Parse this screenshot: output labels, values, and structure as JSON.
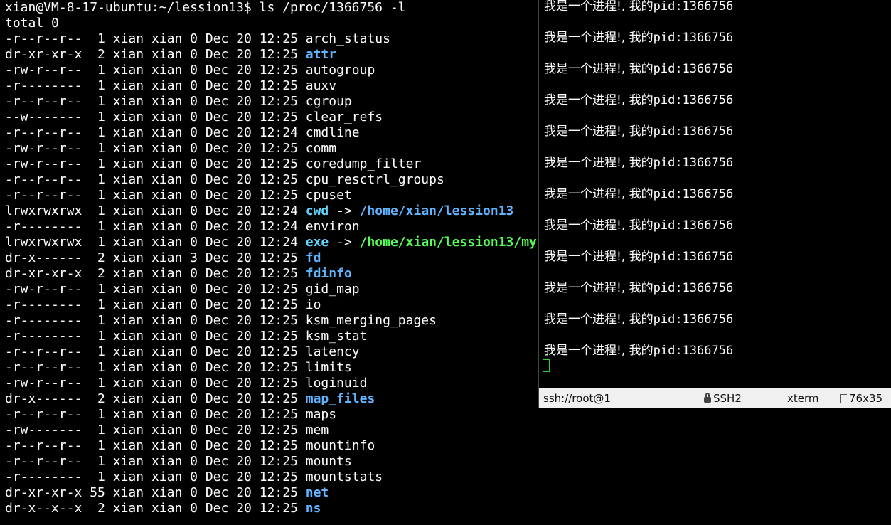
{
  "left_terminal": {
    "prompt": "xian@VM-8-17-ubuntu:~/lession13$ ls /proc/1366756 -l",
    "total": "total 0",
    "entries": [
      {
        "perm": "-r--r--r--",
        "links": " 1",
        "owner": "xian",
        "group": "xian",
        "size": "0",
        "date": "Dec 20",
        "time": "12:25",
        "name": "arch_status",
        "type": "file"
      },
      {
        "perm": "dr-xr-xr-x",
        "links": " 2",
        "owner": "xian",
        "group": "xian",
        "size": "0",
        "date": "Dec 20",
        "time": "12:25",
        "name": "attr",
        "type": "dir"
      },
      {
        "perm": "-rw-r--r--",
        "links": " 1",
        "owner": "xian",
        "group": "xian",
        "size": "0",
        "date": "Dec 20",
        "time": "12:25",
        "name": "autogroup",
        "type": "file"
      },
      {
        "perm": "-r--------",
        "links": " 1",
        "owner": "xian",
        "group": "xian",
        "size": "0",
        "date": "Dec 20",
        "time": "12:25",
        "name": "auxv",
        "type": "file"
      },
      {
        "perm": "-r--r--r--",
        "links": " 1",
        "owner": "xian",
        "group": "xian",
        "size": "0",
        "date": "Dec 20",
        "time": "12:25",
        "name": "cgroup",
        "type": "file"
      },
      {
        "perm": "--w-------",
        "links": " 1",
        "owner": "xian",
        "group": "xian",
        "size": "0",
        "date": "Dec 20",
        "time": "12:25",
        "name": "clear_refs",
        "type": "file"
      },
      {
        "perm": "-r--r--r--",
        "links": " 1",
        "owner": "xian",
        "group": "xian",
        "size": "0",
        "date": "Dec 20",
        "time": "12:24",
        "name": "cmdline",
        "type": "file"
      },
      {
        "perm": "-rw-r--r--",
        "links": " 1",
        "owner": "xian",
        "group": "xian",
        "size": "0",
        "date": "Dec 20",
        "time": "12:25",
        "name": "comm",
        "type": "file"
      },
      {
        "perm": "-rw-r--r--",
        "links": " 1",
        "owner": "xian",
        "group": "xian",
        "size": "0",
        "date": "Dec 20",
        "time": "12:25",
        "name": "coredump_filter",
        "type": "file"
      },
      {
        "perm": "-r--r--r--",
        "links": " 1",
        "owner": "xian",
        "group": "xian",
        "size": "0",
        "date": "Dec 20",
        "time": "12:25",
        "name": "cpu_resctrl_groups",
        "type": "file"
      },
      {
        "perm": "-r--r--r--",
        "links": " 1",
        "owner": "xian",
        "group": "xian",
        "size": "0",
        "date": "Dec 20",
        "time": "12:25",
        "name": "cpuset",
        "type": "file"
      },
      {
        "perm": "lrwxrwxrwx",
        "links": " 1",
        "owner": "xian",
        "group": "xian",
        "size": "0",
        "date": "Dec 20",
        "time": "12:24",
        "name": "cwd",
        "type": "link",
        "arrow": " -> ",
        "target": "/home/xian/lession13",
        "target_type": "dir"
      },
      {
        "perm": "-r--------",
        "links": " 1",
        "owner": "xian",
        "group": "xian",
        "size": "0",
        "date": "Dec 20",
        "time": "12:24",
        "name": "environ",
        "type": "file"
      },
      {
        "perm": "lrwxrwxrwx",
        "links": " 1",
        "owner": "xian",
        "group": "xian",
        "size": "0",
        "date": "Dec 20",
        "time": "12:24",
        "name": "exe",
        "type": "link",
        "arrow": " -> ",
        "target": "/home/xian/lession13/my",
        "target_type": "exe"
      },
      {
        "perm": "dr-x------",
        "links": " 2",
        "owner": "xian",
        "group": "xian",
        "size": "3",
        "date": "Dec 20",
        "time": "12:25",
        "name": "fd",
        "type": "dir"
      },
      {
        "perm": "dr-xr-xr-x",
        "links": " 2",
        "owner": "xian",
        "group": "xian",
        "size": "0",
        "date": "Dec 20",
        "time": "12:25",
        "name": "fdinfo",
        "type": "dir"
      },
      {
        "perm": "-rw-r--r--",
        "links": " 1",
        "owner": "xian",
        "group": "xian",
        "size": "0",
        "date": "Dec 20",
        "time": "12:25",
        "name": "gid_map",
        "type": "file"
      },
      {
        "perm": "-r--------",
        "links": " 1",
        "owner": "xian",
        "group": "xian",
        "size": "0",
        "date": "Dec 20",
        "time": "12:25",
        "name": "io",
        "type": "file"
      },
      {
        "perm": "-r--------",
        "links": " 1",
        "owner": "xian",
        "group": "xian",
        "size": "0",
        "date": "Dec 20",
        "time": "12:25",
        "name": "ksm_merging_pages",
        "type": "file"
      },
      {
        "perm": "-r--------",
        "links": " 1",
        "owner": "xian",
        "group": "xian",
        "size": "0",
        "date": "Dec 20",
        "time": "12:25",
        "name": "ksm_stat",
        "type": "file"
      },
      {
        "perm": "-r--r--r--",
        "links": " 1",
        "owner": "xian",
        "group": "xian",
        "size": "0",
        "date": "Dec 20",
        "time": "12:25",
        "name": "latency",
        "type": "file"
      },
      {
        "perm": "-r--r--r--",
        "links": " 1",
        "owner": "xian",
        "group": "xian",
        "size": "0",
        "date": "Dec 20",
        "time": "12:25",
        "name": "limits",
        "type": "file"
      },
      {
        "perm": "-rw-r--r--",
        "links": " 1",
        "owner": "xian",
        "group": "xian",
        "size": "0",
        "date": "Dec 20",
        "time": "12:25",
        "name": "loginuid",
        "type": "file"
      },
      {
        "perm": "dr-x------",
        "links": " 2",
        "owner": "xian",
        "group": "xian",
        "size": "0",
        "date": "Dec 20",
        "time": "12:25",
        "name": "map_files",
        "type": "dir"
      },
      {
        "perm": "-r--r--r--",
        "links": " 1",
        "owner": "xian",
        "group": "xian",
        "size": "0",
        "date": "Dec 20",
        "time": "12:25",
        "name": "maps",
        "type": "file"
      },
      {
        "perm": "-rw-------",
        "links": " 1",
        "owner": "xian",
        "group": "xian",
        "size": "0",
        "date": "Dec 20",
        "time": "12:25",
        "name": "mem",
        "type": "file"
      },
      {
        "perm": "-r--r--r--",
        "links": " 1",
        "owner": "xian",
        "group": "xian",
        "size": "0",
        "date": "Dec 20",
        "time": "12:25",
        "name": "mountinfo",
        "type": "file"
      },
      {
        "perm": "-r--r--r--",
        "links": " 1",
        "owner": "xian",
        "group": "xian",
        "size": "0",
        "date": "Dec 20",
        "time": "12:25",
        "name": "mounts",
        "type": "file"
      },
      {
        "perm": "-r--------",
        "links": " 1",
        "owner": "xian",
        "group": "xian",
        "size": "0",
        "date": "Dec 20",
        "time": "12:25",
        "name": "mountstats",
        "type": "file"
      },
      {
        "perm": "dr-xr-xr-x",
        "links": "55",
        "owner": "xian",
        "group": "xian",
        "size": "0",
        "date": "Dec 20",
        "time": "12:25",
        "name": "net",
        "type": "dir"
      },
      {
        "perm": "dr-x--x--x",
        "links": " 2",
        "owner": "xian",
        "group": "xian",
        "size": "0",
        "date": "Dec 20",
        "time": "12:25",
        "name": "ns",
        "type": "dir"
      }
    ]
  },
  "right_terminal": {
    "output_lines": [
      {
        "text": "我是一个进程!, 我的",
        "pid": "pid:1366756"
      },
      {
        "text": "我是一个进程!, 我的",
        "pid": "pid:1366756"
      },
      {
        "text": "我是一个进程!, 我的",
        "pid": "pid:1366756"
      },
      {
        "text": "我是一个进程!, 我的",
        "pid": "pid:1366756"
      },
      {
        "text": "我是一个进程!, 我的",
        "pid": "pid:1366756"
      },
      {
        "text": "我是一个进程!, 我的",
        "pid": "pid:1366756"
      },
      {
        "text": "我是一个进程!, 我的",
        "pid": "pid:1366756"
      },
      {
        "text": "我是一个进程!, 我的",
        "pid": "pid:1366756"
      },
      {
        "text": "我是一个进程!, 我的",
        "pid": "pid:1366756"
      },
      {
        "text": "我是一个进程!, 我的",
        "pid": "pid:1366756"
      },
      {
        "text": "我是一个进程!, 我的",
        "pid": "pid:1366756"
      },
      {
        "text": "我是一个进程!, 我的",
        "pid": "pid:1366756"
      }
    ],
    "statusbar": {
      "connection": "ssh://root@1",
      "protocol": "SSH2",
      "terminal_type": "xterm",
      "size": "76x35"
    }
  },
  "colors": {
    "background": "#000000",
    "text": "#ffffff",
    "directory": "#5fb3ff",
    "exe_target": "#55ff55",
    "cursor": "#2ecc40",
    "statusbar_bg": "#f0f0f0"
  },
  "icons": {
    "protocol": "lock-icon",
    "size": "resize-icon"
  }
}
